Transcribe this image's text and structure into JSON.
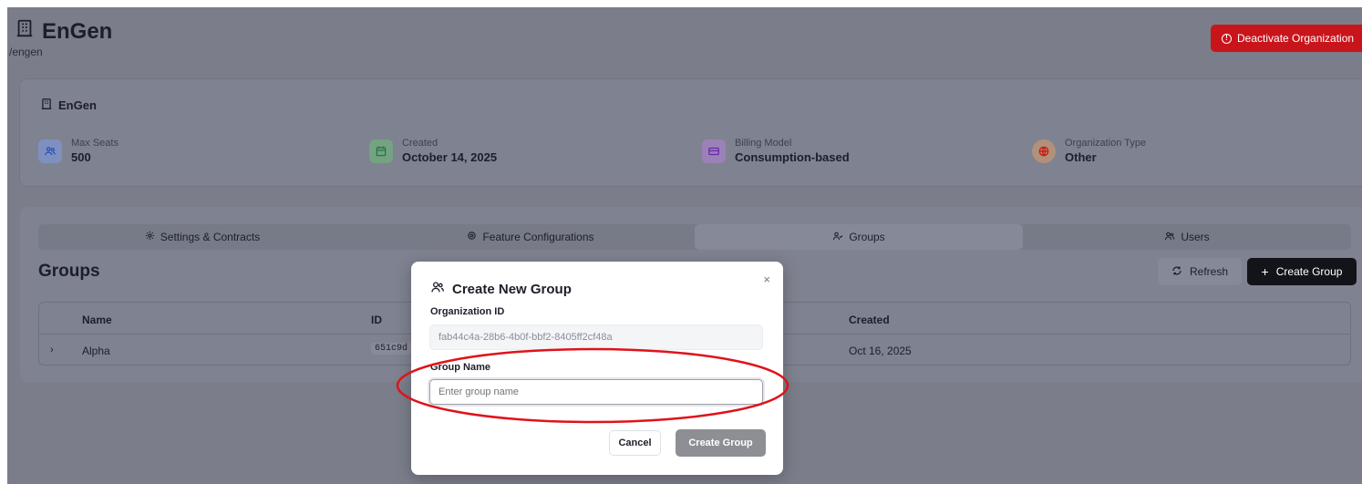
{
  "header": {
    "title": "EnGen",
    "slug": "/engen",
    "deactivate_label": "Deactivate Organization"
  },
  "info": {
    "title": "EnGen",
    "stats": [
      {
        "label": "Max Seats",
        "value": "500",
        "icon": "users-icon",
        "color": "#4a7fe0"
      },
      {
        "label": "Created",
        "value": "October 14, 2025",
        "icon": "calendar-icon",
        "color": "#3fae63"
      },
      {
        "label": "Billing Model",
        "value": "Consumption-based",
        "icon": "credit-card-icon",
        "color": "#9a4fd8"
      },
      {
        "label": "Organization Type",
        "value": "Other",
        "icon": "globe-icon",
        "color": "#e87a1f"
      }
    ]
  },
  "tabs": [
    {
      "label": "Settings & Contracts",
      "icon": "gear-icon",
      "active": false
    },
    {
      "label": "Feature Configurations",
      "icon": "settings-icon",
      "active": false
    },
    {
      "label": "Groups",
      "icon": "user-group-icon",
      "active": true
    },
    {
      "label": "Users",
      "icon": "users-icon",
      "active": false
    }
  ],
  "groups": {
    "heading": "Groups",
    "refresh_label": "Refresh",
    "create_label": "Create Group",
    "columns": {
      "name": "Name",
      "id": "ID",
      "created": "Created"
    },
    "rows": [
      {
        "name": "Alpha",
        "id": "651c9d",
        "created": "Oct 16, 2025"
      }
    ]
  },
  "modal": {
    "title": "Create New Group",
    "close": "×",
    "org_id_label": "Organization ID",
    "org_id_value": "fab44c4a-28b6-4b0f-bbf2-8405ff2cf48a",
    "group_name_label": "Group Name",
    "group_name_placeholder": "Enter group name",
    "group_name_value": "",
    "cancel_label": "Cancel",
    "create_label": "Create Group"
  },
  "colors": {
    "overlay": "#7b7e8a",
    "danger": "#c8151b",
    "primary": "#121419",
    "annotation": "#e0121a"
  }
}
